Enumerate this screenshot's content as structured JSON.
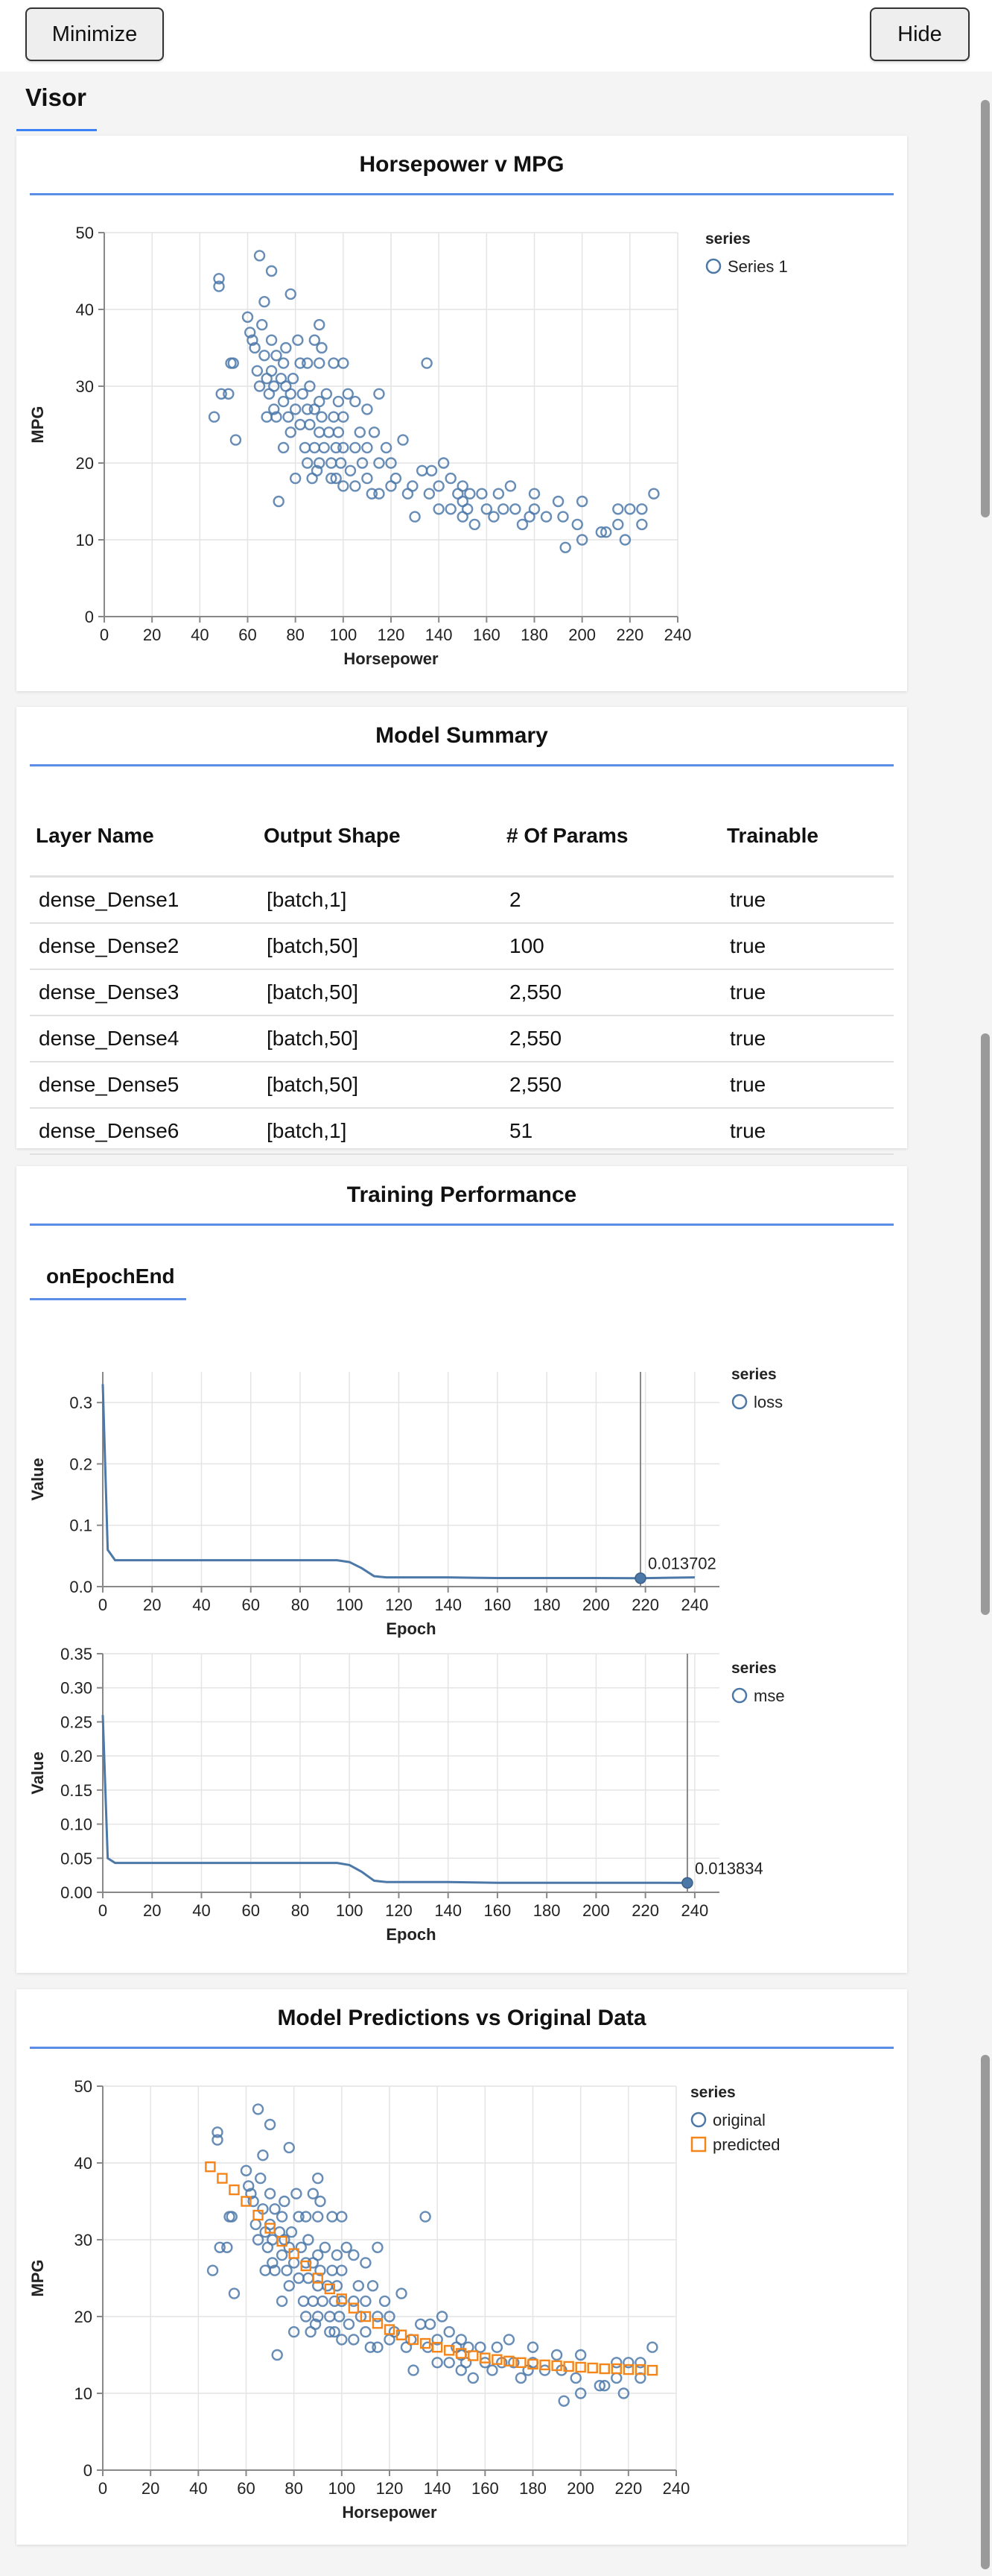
{
  "topbar": {
    "minimize_label": "Minimize",
    "hide_label": "Hide"
  },
  "visor": {
    "tab_label": "Visor"
  },
  "colors": {
    "series_blue": "#4c78a8",
    "series_orange": "#f58518",
    "accent": "#5b8ee6"
  },
  "scatter": {
    "title": "Horsepower v MPG",
    "xlabel": "Horsepower",
    "ylabel": "MPG",
    "legend_title": "series",
    "legend_item": "Series 1"
  },
  "summary": {
    "title": "Model Summary",
    "headers": [
      "Layer Name",
      "Output Shape",
      "# Of Params",
      "Trainable"
    ],
    "rows": [
      [
        "dense_Dense1",
        "[batch,1]",
        "2",
        "true"
      ],
      [
        "dense_Dense2",
        "[batch,50]",
        "100",
        "true"
      ],
      [
        "dense_Dense3",
        "[batch,50]",
        "2,550",
        "true"
      ],
      [
        "dense_Dense4",
        "[batch,50]",
        "2,550",
        "true"
      ],
      [
        "dense_Dense5",
        "[batch,50]",
        "2,550",
        "true"
      ],
      [
        "dense_Dense6",
        "[batch,1]",
        "51",
        "true"
      ]
    ]
  },
  "training": {
    "title": "Training Performance",
    "tab_label": "onEpochEnd",
    "loss": {
      "xlabel": "Epoch",
      "ylabel": "Value",
      "legend_title": "series",
      "legend_item": "loss",
      "tooltip_value": "0.013702"
    },
    "mse": {
      "xlabel": "Epoch",
      "ylabel": "Value",
      "legend_title": "series",
      "legend_item": "mse",
      "tooltip_value": "0.013834"
    }
  },
  "predictions": {
    "title": "Model Predictions vs Original Data",
    "xlabel": "Horsepower",
    "ylabel": "MPG",
    "legend_title": "series",
    "legend_original": "original",
    "legend_predicted": "predicted"
  },
  "chart_data": [
    {
      "type": "scatter",
      "title": "Horsepower v MPG",
      "xlabel": "Horsepower",
      "ylabel": "MPG",
      "xlim": [
        0,
        240
      ],
      "ylim": [
        0,
        50
      ],
      "xticks": [
        0,
        20,
        40,
        60,
        80,
        100,
        120,
        140,
        160,
        180,
        200,
        220,
        240
      ],
      "yticks": [
        0,
        10,
        20,
        30,
        40,
        50
      ],
      "grid": true,
      "legend": "top-right",
      "series": [
        {
          "name": "Series 1",
          "points": [
            [
              46,
              26
            ],
            [
              48,
              44
            ],
            [
              48,
              43
            ],
            [
              49,
              29
            ],
            [
              52,
              29
            ],
            [
              53,
              33
            ],
            [
              54,
              33
            ],
            [
              55,
              23
            ],
            [
              60,
              39
            ],
            [
              61,
              37
            ],
            [
              62,
              36
            ],
            [
              63,
              35
            ],
            [
              64,
              32
            ],
            [
              65,
              47
            ],
            [
              65,
              30
            ],
            [
              66,
              38
            ],
            [
              67,
              41
            ],
            [
              67,
              34
            ],
            [
              68,
              31
            ],
            [
              68,
              26
            ],
            [
              69,
              29
            ],
            [
              70,
              45
            ],
            [
              70,
              36
            ],
            [
              70,
              32
            ],
            [
              71,
              30
            ],
            [
              71,
              27
            ],
            [
              72,
              34
            ],
            [
              72,
              26
            ],
            [
              73,
              15
            ],
            [
              74,
              31
            ],
            [
              75,
              33
            ],
            [
              75,
              28
            ],
            [
              75,
              22
            ],
            [
              76,
              35
            ],
            [
              76,
              30
            ],
            [
              77,
              26
            ],
            [
              78,
              42
            ],
            [
              78,
              29
            ],
            [
              78,
              24
            ],
            [
              79,
              31
            ],
            [
              80,
              18
            ],
            [
              80,
              27
            ],
            [
              81,
              36
            ],
            [
              82,
              33
            ],
            [
              82,
              25
            ],
            [
              83,
              29
            ],
            [
              84,
              22
            ],
            [
              85,
              33
            ],
            [
              85,
              27
            ],
            [
              85,
              20
            ],
            [
              86,
              30
            ],
            [
              86,
              25
            ],
            [
              87,
              18
            ],
            [
              88,
              36
            ],
            [
              88,
              27
            ],
            [
              88,
              22
            ],
            [
              89,
              19
            ],
            [
              90,
              38
            ],
            [
              90,
              33
            ],
            [
              90,
              28
            ],
            [
              90,
              24
            ],
            [
              90,
              20
            ],
            [
              91,
              35
            ],
            [
              91,
              26
            ],
            [
              92,
              22
            ],
            [
              93,
              29
            ],
            [
              94,
              24
            ],
            [
              95,
              20
            ],
            [
              95,
              18
            ],
            [
              96,
              33
            ],
            [
              96,
              26
            ],
            [
              97,
              22
            ],
            [
              97,
              18
            ],
            [
              98,
              28
            ],
            [
              98,
              24
            ],
            [
              99,
              20
            ],
            [
              100,
              33
            ],
            [
              100,
              26
            ],
            [
              100,
              22
            ],
            [
              100,
              17
            ],
            [
              102,
              29
            ],
            [
              103,
              19
            ],
            [
              105,
              28
            ],
            [
              105,
              22
            ],
            [
              105,
              17
            ],
            [
              107,
              24
            ],
            [
              108,
              20
            ],
            [
              110,
              27
            ],
            [
              110,
              22
            ],
            [
              110,
              18
            ],
            [
              112,
              16
            ],
            [
              113,
              24
            ],
            [
              115,
              29
            ],
            [
              115,
              20
            ],
            [
              115,
              16
            ],
            [
              118,
              22
            ],
            [
              120,
              20
            ],
            [
              120,
              17
            ],
            [
              122,
              18
            ],
            [
              125,
              23
            ],
            [
              127,
              16
            ],
            [
              129,
              17
            ],
            [
              130,
              13
            ],
            [
              133,
              19
            ],
            [
              135,
              33
            ],
            [
              136,
              16
            ],
            [
              137,
              19
            ],
            [
              140,
              17
            ],
            [
              140,
              14
            ],
            [
              142,
              20
            ],
            [
              145,
              18
            ],
            [
              145,
              14
            ],
            [
              148,
              16
            ],
            [
              150,
              17
            ],
            [
              150,
              15
            ],
            [
              150,
              13
            ],
            [
              152,
              14
            ],
            [
              153,
              16
            ],
            [
              155,
              12
            ],
            [
              158,
              16
            ],
            [
              160,
              14
            ],
            [
              163,
              13
            ],
            [
              165,
              16
            ],
            [
              167,
              14
            ],
            [
              170,
              17
            ],
            [
              172,
              14
            ],
            [
              175,
              12
            ],
            [
              178,
              13
            ],
            [
              180,
              16
            ],
            [
              180,
              14
            ],
            [
              185,
              13
            ],
            [
              190,
              15
            ],
            [
              192,
              13
            ],
            [
              193,
              9
            ],
            [
              198,
              12
            ],
            [
              200,
              15
            ],
            [
              200,
              10
            ],
            [
              208,
              11
            ],
            [
              210,
              11
            ],
            [
              215,
              14
            ],
            [
              215,
              12
            ],
            [
              218,
              10
            ],
            [
              220,
              14
            ],
            [
              225,
              14
            ],
            [
              225,
              12
            ],
            [
              230,
              16
            ]
          ]
        }
      ]
    },
    {
      "type": "line",
      "title": "",
      "xlabel": "Epoch",
      "ylabel": "Value",
      "xlim": [
        0,
        250
      ],
      "ylim": [
        0,
        0.35
      ],
      "xticks": [
        0,
        20,
        40,
        60,
        80,
        100,
        120,
        140,
        160,
        180,
        200,
        220,
        240
      ],
      "yticks": [
        0.0,
        0.1,
        0.2,
        0.3
      ],
      "grid": true,
      "legend": "top-right",
      "series": [
        {
          "name": "loss",
          "x": [
            0,
            2,
            5,
            10,
            20,
            40,
            60,
            80,
            95,
            100,
            105,
            110,
            115,
            120,
            140,
            160,
            180,
            200,
            218,
            240
          ],
          "y": [
            0.33,
            0.06,
            0.043,
            0.043,
            0.043,
            0.043,
            0.043,
            0.043,
            0.043,
            0.04,
            0.03,
            0.017,
            0.015,
            0.015,
            0.015,
            0.014,
            0.014,
            0.014,
            0.013702,
            0.015
          ]
        }
      ],
      "annotations": [
        {
          "x": 218,
          "y": 0.013702,
          "text": "0.013702"
        }
      ]
    },
    {
      "type": "line",
      "title": "",
      "xlabel": "Epoch",
      "ylabel": "Value",
      "xlim": [
        0,
        250
      ],
      "ylim": [
        0,
        0.35
      ],
      "xticks": [
        0,
        20,
        40,
        60,
        80,
        100,
        120,
        140,
        160,
        180,
        200,
        220,
        240
      ],
      "yticks": [
        0.0,
        0.05,
        0.1,
        0.15,
        0.2,
        0.25,
        0.3,
        0.35
      ],
      "grid": true,
      "legend": "top-right",
      "series": [
        {
          "name": "mse",
          "x": [
            0,
            2,
            5,
            10,
            20,
            40,
            60,
            80,
            95,
            100,
            105,
            110,
            115,
            120,
            140,
            160,
            180,
            200,
            220,
            237
          ],
          "y": [
            0.26,
            0.05,
            0.043,
            0.043,
            0.043,
            0.043,
            0.043,
            0.043,
            0.043,
            0.04,
            0.03,
            0.017,
            0.015,
            0.015,
            0.015,
            0.014,
            0.014,
            0.014,
            0.014,
            0.013834
          ]
        }
      ],
      "annotations": [
        {
          "x": 237,
          "y": 0.013834,
          "text": "0.013834"
        }
      ]
    },
    {
      "type": "scatter",
      "title": "Model Predictions vs Original Data",
      "xlabel": "Horsepower",
      "ylabel": "MPG",
      "xlim": [
        0,
        240
      ],
      "ylim": [
        0,
        50
      ],
      "xticks": [
        0,
        20,
        40,
        60,
        80,
        100,
        120,
        140,
        160,
        180,
        200,
        220,
        240
      ],
      "yticks": [
        0,
        10,
        20,
        30,
        40,
        50
      ],
      "grid": true,
      "legend": "top-right",
      "series": [
        {
          "name": "original",
          "points": "same as Horsepower v MPG Series 1"
        },
        {
          "name": "predicted",
          "x": [
            45,
            50,
            55,
            60,
            65,
            70,
            75,
            80,
            85,
            90,
            95,
            100,
            105,
            110,
            115,
            120,
            125,
            130,
            135,
            140,
            145,
            150,
            155,
            160,
            165,
            170,
            175,
            180,
            185,
            190,
            195,
            200,
            205,
            210,
            215,
            220,
            225,
            230
          ],
          "y": [
            39.5,
            38.0,
            36.5,
            35.0,
            33.2,
            31.5,
            29.8,
            28.2,
            26.6,
            25.0,
            23.6,
            22.3,
            21.1,
            20.0,
            19.1,
            18.3,
            17.6,
            17.0,
            16.5,
            16.0,
            15.6,
            15.2,
            14.9,
            14.6,
            14.4,
            14.2,
            14.0,
            13.8,
            13.7,
            13.6,
            13.5,
            13.4,
            13.3,
            13.2,
            13.2,
            13.1,
            13.1,
            13.0
          ]
        }
      ]
    }
  ]
}
